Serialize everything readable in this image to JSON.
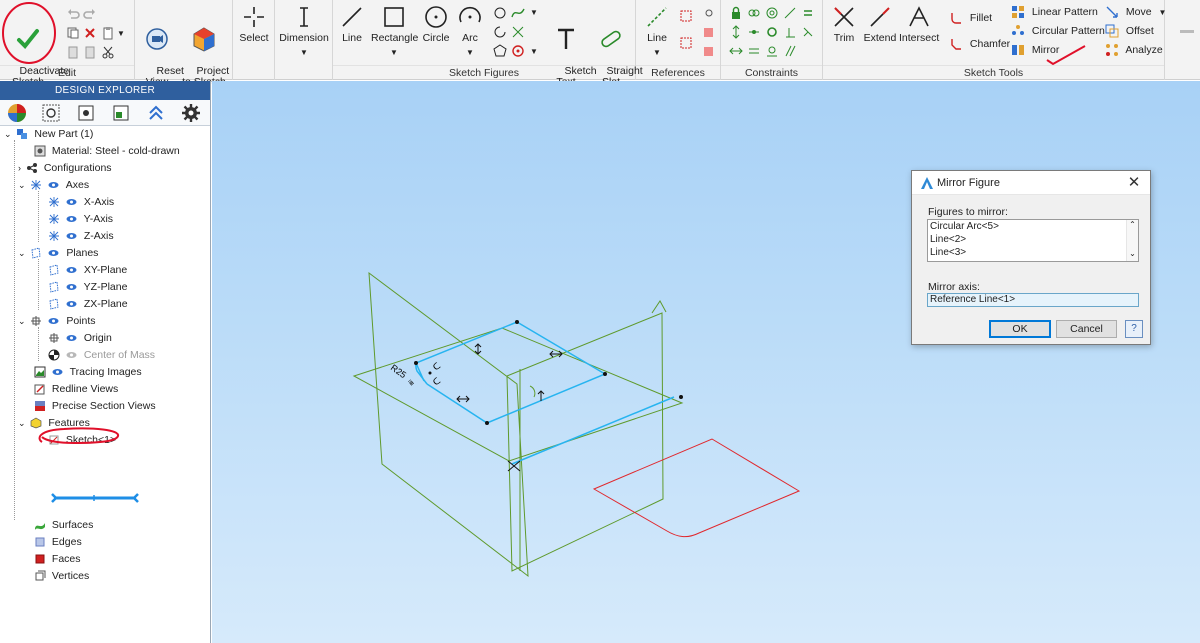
{
  "ribbon": {
    "edit": {
      "label": "Edit",
      "deactivate_sketch": "Deactivate\nSketch"
    },
    "reset_view": "Reset\nView",
    "project_to_sketch": "Project\nto Sketch",
    "select": "Select",
    "dimension": "Dimension",
    "sketch_figures": {
      "label": "Sketch Figures",
      "line": "Line",
      "rectangle": "Rectangle",
      "circle": "Circle",
      "arc": "Arc",
      "sketch_text": "Sketch\nText",
      "straight_slot": "Straight\nSlot"
    },
    "references": {
      "label": "References",
      "line": "Line"
    },
    "constraints": {
      "label": "Constraints"
    },
    "sketch_tools": {
      "label": "Sketch Tools",
      "trim": "Trim",
      "extend": "Extend",
      "intersect": "Intersect",
      "fillet": "Fillet",
      "chamfer": "Chamfer",
      "linear_pattern": "Linear Pattern",
      "circular_pattern": "Circular Pattern",
      "mirror": "Mirror",
      "move": "Move",
      "offset": "Offset",
      "analyze": "Analyze"
    }
  },
  "explorer": {
    "title": "DESIGN EXPLORER",
    "tree": {
      "root": "New Part (1)",
      "material": "Material: Steel - cold-drawn",
      "configurations": "Configurations",
      "axes": "Axes",
      "x_axis": "X-Axis",
      "y_axis": "Y-Axis",
      "z_axis": "Z-Axis",
      "planes": "Planes",
      "xy_plane": "XY-Plane",
      "yz_plane": "YZ-Plane",
      "zx_plane": "ZX-Plane",
      "points": "Points",
      "origin": "Origin",
      "center_of_mass": "Center of Mass",
      "tracing_images": "Tracing Images",
      "redline_views": "Redline Views",
      "precise_section_views": "Precise Section Views",
      "features": "Features",
      "sketch1": "Sketch<1>",
      "surfaces": "Surfaces",
      "edges": "Edges",
      "faces": "Faces",
      "vertices": "Vertices"
    }
  },
  "viewport": {
    "dimension_label": "R25"
  },
  "dialog": {
    "title": "Mirror Figure",
    "figures_label": "Figures to mirror:",
    "figures": [
      "Circular Arc<5>",
      "Line<2>",
      "Line<3>"
    ],
    "axis_label": "Mirror axis:",
    "axis_value": "Reference Line<1>",
    "ok": "OK",
    "cancel": "Cancel",
    "help": "?"
  },
  "colors": {
    "accent_blue": "#2f5f9e",
    "sketch_cyan": "#27b4f0",
    "plane_green": "#5f9a2c",
    "mirror_red": "#e0282d",
    "annotation_red": "#e0102a"
  }
}
